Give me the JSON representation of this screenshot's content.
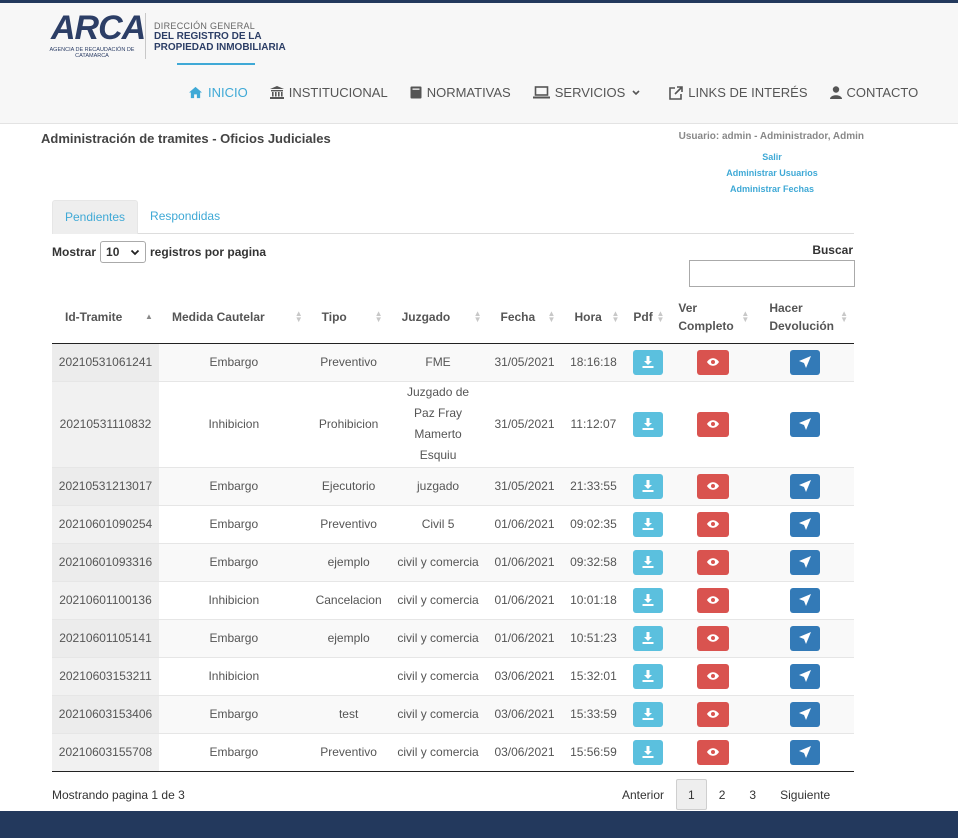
{
  "brand": {
    "logo": "ARCA",
    "logo_sub": "AGENCIA DE RECAUDACIÓN DE CATAMARCA",
    "line1": "DIRECCIÓN GENERAL",
    "line2": "DEL REGISTRO DE LA",
    "line3": "PROPIEDAD INMOBILIARIA"
  },
  "nav": [
    {
      "label": "INICIO",
      "icon": "home-icon",
      "active": true
    },
    {
      "label": "INSTITUCIONAL",
      "icon": "institution-icon"
    },
    {
      "label": "NORMATIVAS",
      "icon": "book-icon"
    },
    {
      "label": "SERVICIOS",
      "icon": "laptop-icon"
    },
    {
      "label": "LINKS DE INTERÉS",
      "icon": "external-link-icon"
    },
    {
      "label": "CONTACTO",
      "icon": "user-icon"
    }
  ],
  "page_title": "Administración de tramites - Oficios Judiciales",
  "user": {
    "line": "Usuario: admin - Administrador, Admin",
    "links": [
      "Salir",
      "Administrar Usuarios",
      "Administrar Fechas"
    ]
  },
  "tabs": [
    "Pendientes",
    "Respondidas"
  ],
  "length": {
    "prefix": "Mostrar",
    "value": "10",
    "suffix": "registros por pagina"
  },
  "search_label": "Buscar",
  "columns": [
    "Id-Tramite",
    "Medida Cautelar",
    "Tipo",
    "Juzgado",
    "Fecha",
    "Hora",
    "Pdf",
    "Ver Completo",
    "Hacer Devolución"
  ],
  "rows": [
    [
      "20210531061241",
      "Embargo",
      "Preventivo",
      "FME",
      "31/05/2021",
      "18:16:18"
    ],
    [
      "20210531110832",
      "Inhibicion",
      "Prohibicion",
      "Juzgado de Paz Fray Mamerto Esquiu",
      "31/05/2021",
      "11:12:07"
    ],
    [
      "20210531213017",
      "Embargo",
      "Ejecutorio",
      "juzgado",
      "31/05/2021",
      "21:33:55"
    ],
    [
      "20210601090254",
      "Embargo",
      "Preventivo",
      "Civil 5",
      "01/06/2021",
      "09:02:35"
    ],
    [
      "20210601093316",
      "Embargo",
      "ejemplo",
      "civil y comercia",
      "01/06/2021",
      "09:32:58"
    ],
    [
      "20210601100136",
      "Inhibicion",
      "Cancelacion",
      "civil y comercia",
      "01/06/2021",
      "10:01:18"
    ],
    [
      "20210601105141",
      "Embargo",
      "ejemplo",
      "civil y comercia",
      "01/06/2021",
      "10:51:23"
    ],
    [
      "20210603153211",
      "Inhibicion",
      "",
      "civil y comercia",
      "03/06/2021",
      "15:32:01"
    ],
    [
      "20210603153406",
      "Embargo",
      "test",
      "civil y comercia",
      "03/06/2021",
      "15:33:59"
    ],
    [
      "20210603155708",
      "Embargo",
      "Preventivo",
      "civil y comercia",
      "03/06/2021",
      "15:56:59"
    ]
  ],
  "info": "Mostrando pagina 1 de 3",
  "pager": {
    "prev": "Anterior",
    "pages": [
      "1",
      "2",
      "3"
    ],
    "next": "Siguiente"
  },
  "colors": {
    "accent": "#3fa9d6",
    "navy": "#23395d",
    "pdf": "#5bc0de",
    "ver": "#d9534f",
    "dev": "#337ab7"
  }
}
